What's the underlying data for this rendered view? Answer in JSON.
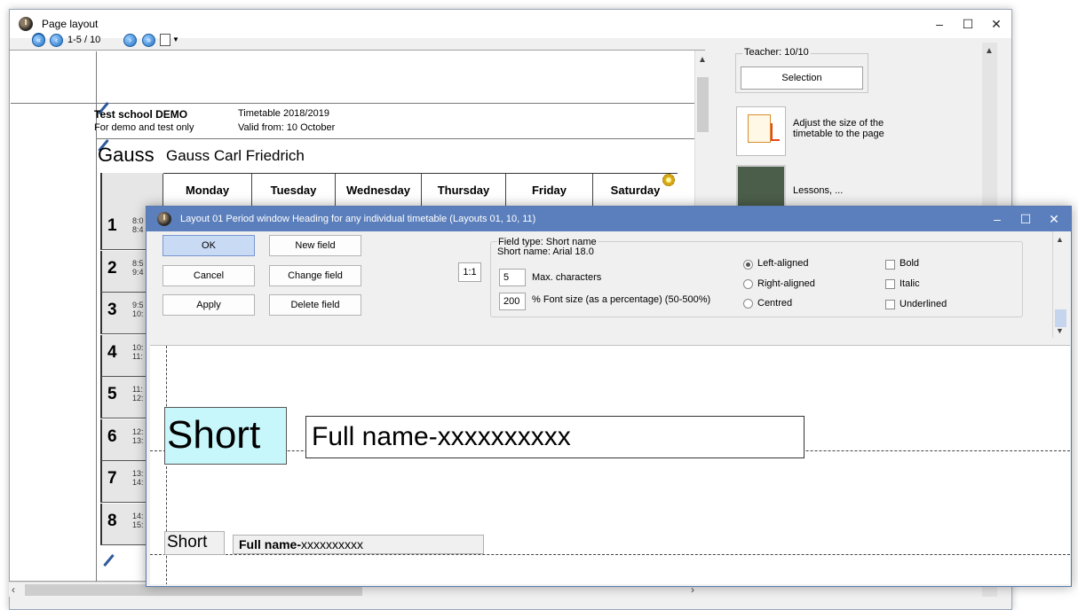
{
  "main_window": {
    "title": "Page layout",
    "controls": [
      "–",
      "☐",
      "✕"
    ]
  },
  "toolbar": {
    "page_range": "1-5 / 10",
    "nav_icons": [
      "first-page-icon",
      "prev-page-icon",
      "next-page-icon",
      "last-page-icon",
      "page-view-icon"
    ]
  },
  "preview": {
    "school_name": "Test school  DEMO",
    "school_sub": "For demo and test only",
    "timetable_year": "Timetable 2018/2019",
    "valid_from": "Valid from: 10 October",
    "teacher_short": "Gauss",
    "teacher_full": "Gauss Carl Friedrich",
    "days": [
      "Monday",
      "Tuesday",
      "Wednesday",
      "Thursday",
      "Friday",
      "Saturday"
    ],
    "periods": [
      {
        "num": "1",
        "t1": "8:0",
        "t2": "8:4"
      },
      {
        "num": "2",
        "t1": "8:5",
        "t2": "9:4"
      },
      {
        "num": "3",
        "t1": "9:5",
        "t2": "10:"
      },
      {
        "num": "4",
        "t1": "10:",
        "t2": "11:"
      },
      {
        "num": "5",
        "t1": "11:",
        "t2": "12:"
      },
      {
        "num": "6",
        "t1": "12:",
        "t2": "13:"
      },
      {
        "num": "7",
        "t1": "13:",
        "t2": "14:"
      },
      {
        "num": "8",
        "t1": "14:",
        "t2": "15:"
      }
    ]
  },
  "side_panel": {
    "teacher_count": "Teacher: 10/10",
    "selection_label": "Selection",
    "adjust_label": "Adjust the size of the timetable to the page",
    "lessons_label": "Lessons, ..."
  },
  "dialog": {
    "title": "Layout 01  Period window  Heading for any individual timetable (Layouts 01, 10, 11)",
    "controls": [
      "–",
      "☐",
      "✕"
    ],
    "buttons": {
      "ok": "OK",
      "cancel": "Cancel",
      "apply": "Apply",
      "new_field": "New field",
      "change_field": "Change field",
      "delete_field": "Delete field",
      "ratio": "1:1"
    },
    "field_type": "Field type: Short name",
    "field_font": "Short name: Arial 18.0",
    "max_chars_value": "5",
    "max_chars_label": "Max. characters",
    "font_size_value": "200",
    "font_size_label": "% Font size (as a percentage) (50-500%)",
    "alignment": [
      {
        "label": "Left-aligned",
        "checked": true
      },
      {
        "label": "Right-aligned",
        "checked": false
      },
      {
        "label": "Centred",
        "checked": false
      }
    ],
    "styles": [
      {
        "label": "Bold",
        "checked": false
      },
      {
        "label": "Italic",
        "checked": false
      },
      {
        "label": "Underlined",
        "checked": false
      }
    ],
    "design": {
      "big_short": "Short",
      "big_full": "Full name-xxxxxxxxxx",
      "small_short": "Short",
      "small_full_bold": "Full name-",
      "small_full_rest": "xxxxxxxxxx"
    }
  }
}
